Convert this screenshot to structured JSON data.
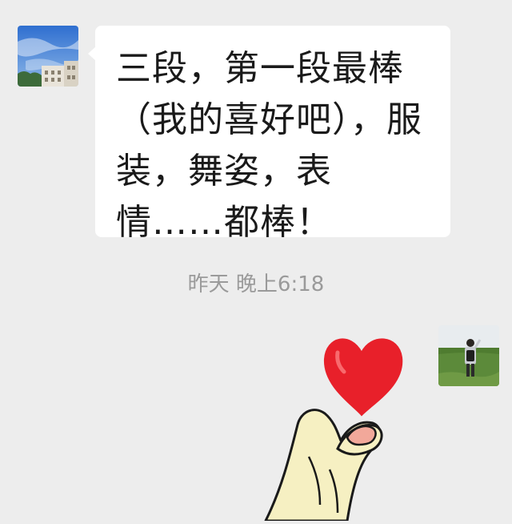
{
  "message": {
    "text": "三段，第一段最棒（我的喜好吧），服装，舞姿，表情……都棒！"
  },
  "timestamp": {
    "text": "昨天 晚上6:18"
  },
  "colors": {
    "background": "#ededed",
    "bubble": "#ffffff",
    "text": "#1a1a1a",
    "timestamp": "#9a9a9a",
    "heart": "#e8202a"
  },
  "icons": {
    "sticker": "finger-heart-sticker"
  }
}
